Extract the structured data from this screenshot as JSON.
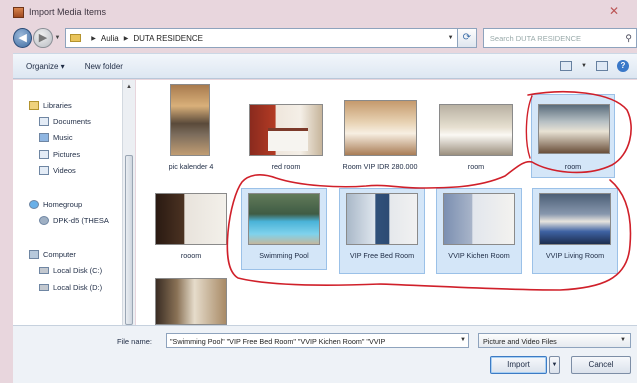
{
  "window": {
    "title": "Import Media Items",
    "close_label": "✕"
  },
  "address": {
    "path": [
      "Aulia",
      "DUTA RESIDENCE"
    ],
    "search_placeholder": "Search DUTA RESIDENCE"
  },
  "toolbar": {
    "organize_label": "Organize ▾",
    "new_folder_label": "New folder"
  },
  "nav": {
    "libraries": "Libraries",
    "documents": "Documents",
    "music": "Music",
    "pictures": "Pictures",
    "videos": "Videos",
    "homegroup": "Homegroup",
    "homegroup_user": "DPK-d5 (THESA",
    "computer": "Computer",
    "disk_c": "Local Disk (C:)",
    "disk_d": "Local Disk (D:)"
  },
  "files": [
    {
      "label": "pic kalender 4",
      "selected": false
    },
    {
      "label": "red room",
      "selected": false
    },
    {
      "label": "Room VIP IDR 280.000",
      "selected": false
    },
    {
      "label": "room",
      "selected": false
    },
    {
      "label": "room",
      "selected": true
    },
    {
      "label": "rooom",
      "selected": false
    },
    {
      "label": "Swimming Pool",
      "selected": true
    },
    {
      "label": "VIP Free Bed Room",
      "selected": true
    },
    {
      "label": "VVIP Kichen Room",
      "selected": true
    },
    {
      "label": "VVIP Living Room",
      "selected": true
    },
    {
      "label": "",
      "selected": false
    }
  ],
  "bottom": {
    "file_name_label": "File name:",
    "file_name_value": "\"Swimming Pool\" \"VIP Free Bed Room\" \"VVIP Kichen Room\" \"VVIP",
    "file_type": "Picture and Video Files",
    "import_label": "Import",
    "cancel_label": "Cancel"
  },
  "colors": {
    "selection": "#d4e6f8",
    "annotation": "#d0202a"
  }
}
